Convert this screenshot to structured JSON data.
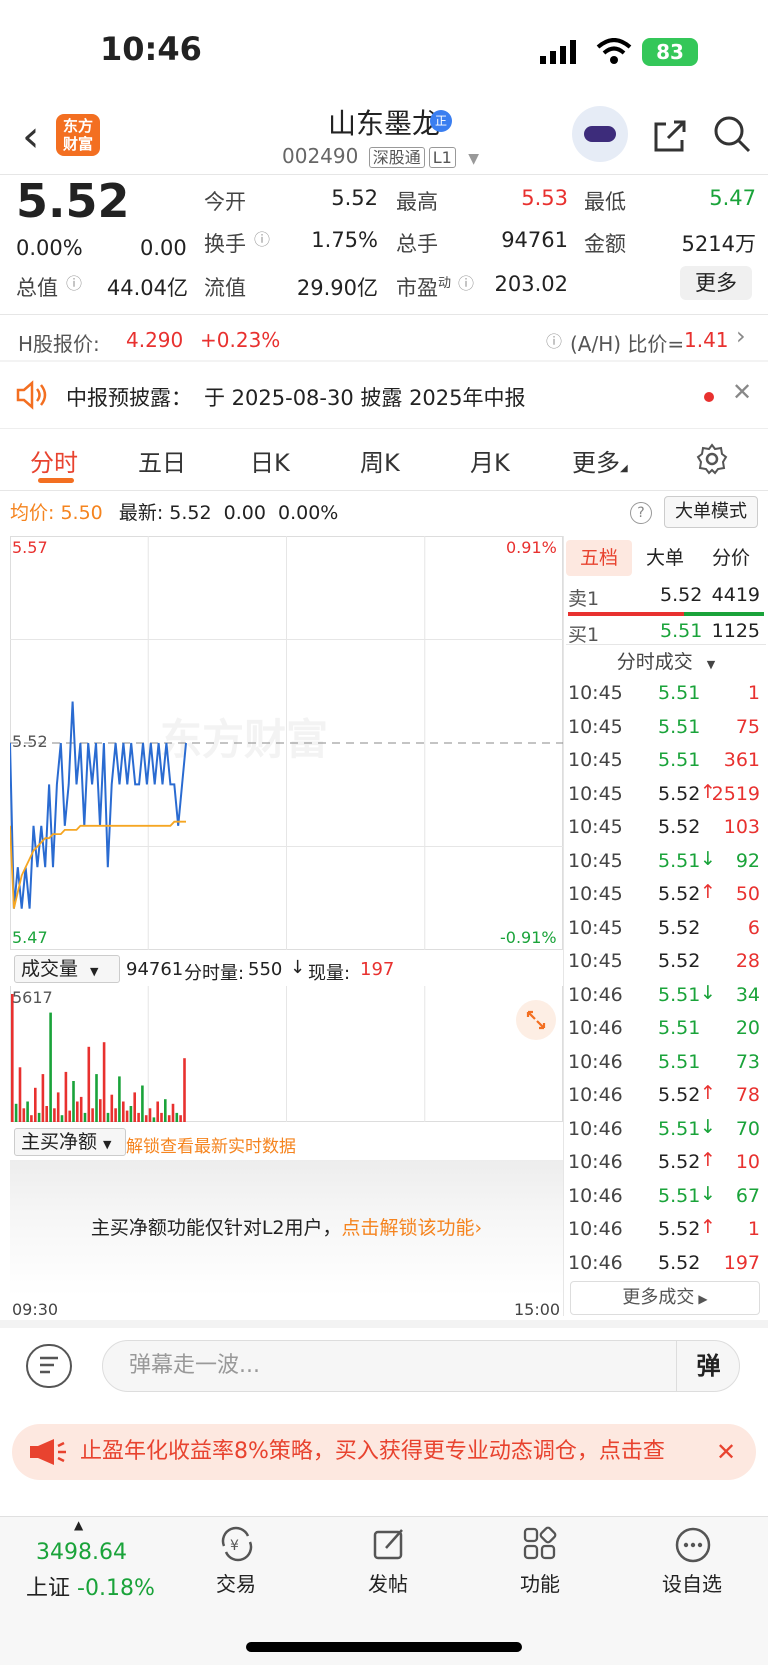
{
  "status": {
    "time": "10:46",
    "battery": "83"
  },
  "header": {
    "logo_line1": "东方",
    "logo_line2": "财富",
    "stock_name": "山东墨龙",
    "badge": "正",
    "code": "002490",
    "tag1": "深股通",
    "tag2": "L1"
  },
  "quote": {
    "price": "5.52",
    "change_pct": "0.00%",
    "change": "0.00",
    "open_label": "今开",
    "open": "5.52",
    "high_label": "最高",
    "high": "5.53",
    "low_label": "最低",
    "low": "5.47",
    "turnover_label": "换手",
    "turnover": "1.75%",
    "volume_label": "总手",
    "volume": "94761",
    "amount_label": "金额",
    "amount": "5214万",
    "mktcap_label": "总值",
    "mktcap": "44.04亿",
    "float_label": "流值",
    "float": "29.90亿",
    "pe_label": "市盈",
    "pe_sup": "动",
    "pe": "203.02",
    "more": "更多"
  },
  "hshare": {
    "label": "H股报价:",
    "price": "4.290",
    "change": "+0.23%",
    "ah_label": "(A/H) 比价=",
    "ah_value": "1.41"
  },
  "notice": {
    "label": "中报预披露：",
    "text": "于 2025-08-30 披露 2025年中报"
  },
  "tabs": [
    "分时",
    "五日",
    "日K",
    "周K",
    "月K",
    "更多"
  ],
  "chart_info": {
    "avg_label": "均价:",
    "avg": "5.50",
    "latest_label": "最新:",
    "latest": "5.52",
    "chg": "0.00",
    "pct": "0.00%",
    "big_order_mode": "大单模式"
  },
  "chart_data": {
    "type": "line",
    "x": [
      "09:30",
      "15:00"
    ],
    "y_range": [
      5.47,
      5.57
    ],
    "pct_range": [
      "-0.91%",
      "0.91%"
    ],
    "y_top": "5.57",
    "y_bottom": "5.47",
    "y_mid": "5.52",
    "pct_top": "0.91%",
    "pct_bottom": "-0.91%",
    "watermark": "东方财富",
    "series": [
      {
        "values": [
          5.52,
          5.48,
          5.49,
          5.48,
          5.49,
          5.48,
          5.5,
          5.49,
          5.5,
          5.49,
          5.51,
          5.49,
          5.51,
          5.52,
          5.5,
          5.51,
          5.53,
          5.51,
          5.52,
          5.5,
          5.52,
          5.51,
          5.52,
          5.5,
          5.52,
          5.49,
          5.51,
          5.52,
          5.51,
          5.52,
          5.51,
          5.52,
          5.51,
          5.51,
          5.52,
          5.51,
          5.52,
          5.51,
          5.52,
          5.51,
          5.52,
          5.51,
          5.51,
          5.5,
          5.51,
          5.52
        ]
      },
      {
        "values": [
          5.5,
          5.48,
          5.484,
          5.488,
          5.49,
          5.492,
          5.494,
          5.495,
          5.496,
          5.497,
          5.497,
          5.498,
          5.498,
          5.498,
          5.499,
          5.499,
          5.499,
          5.499,
          5.5,
          5.5,
          5.5,
          5.5,
          5.5,
          5.5,
          5.5,
          5.5,
          5.5,
          5.5,
          5.5,
          5.5,
          5.5,
          5.5,
          5.5,
          5.5,
          5.5,
          5.5,
          5.5,
          5.5,
          5.5,
          5.5,
          5.5,
          5.5,
          5.501,
          5.501,
          5.501,
          5.501
        ]
      }
    ],
    "volume_max": "5617",
    "volumes": [
      5617,
      800,
      2400,
      600,
      900,
      300,
      1500,
      400,
      2100,
      700,
      4800,
      600,
      1300,
      300,
      2200,
      500,
      1800,
      900,
      1100,
      400,
      3300,
      600,
      2100,
      1000,
      3500,
      400,
      1200,
      600,
      2000,
      900,
      500,
      700,
      1300,
      400,
      1600,
      300,
      600,
      200,
      900,
      400,
      1000,
      300,
      800,
      400,
      300,
      2800
    ]
  },
  "volume_panel": {
    "select": "成交量",
    "total": "94761",
    "tick_vol_label": "分时量:",
    "tick_vol": "550",
    "cur_vol_label": "现量:",
    "cur_vol": "197"
  },
  "netbuy": {
    "select": "主买净额",
    "unlock_tip": "解锁查看最新实时数据",
    "msg": "主买净额功能仅针对L2用户，",
    "link": "点击解锁该功能"
  },
  "x_start": "09:30",
  "x_end": "15:00",
  "right_panel": {
    "tabs": [
      "五档",
      "大单",
      "分价"
    ],
    "sell1_label": "卖1",
    "sell1_price": "5.52",
    "sell1_vol": "4419",
    "buy1_label": "买1",
    "buy1_price": "5.51",
    "buy1_vol": "1125",
    "trades_header": "分时成交",
    "trades": [
      {
        "t": "10:45",
        "p": "5.51",
        "arrow": "",
        "v": "1",
        "pc": "green",
        "vc": "red"
      },
      {
        "t": "10:45",
        "p": "5.51",
        "arrow": "",
        "v": "75",
        "pc": "green",
        "vc": "red"
      },
      {
        "t": "10:45",
        "p": "5.51",
        "arrow": "",
        "v": "361",
        "pc": "green",
        "vc": "red"
      },
      {
        "t": "10:45",
        "p": "5.52",
        "arrow": "↑",
        "v": "2519",
        "pc": "black",
        "vc": "red"
      },
      {
        "t": "10:45",
        "p": "5.52",
        "arrow": "",
        "v": "103",
        "pc": "black",
        "vc": "red"
      },
      {
        "t": "10:45",
        "p": "5.51",
        "arrow": "↓",
        "v": "92",
        "pc": "green",
        "vc": "green"
      },
      {
        "t": "10:45",
        "p": "5.52",
        "arrow": "↑",
        "v": "50",
        "pc": "black",
        "vc": "red"
      },
      {
        "t": "10:45",
        "p": "5.52",
        "arrow": "",
        "v": "6",
        "pc": "black",
        "vc": "red"
      },
      {
        "t": "10:45",
        "p": "5.52",
        "arrow": "",
        "v": "28",
        "pc": "black",
        "vc": "red"
      },
      {
        "t": "10:46",
        "p": "5.51",
        "arrow": "↓",
        "v": "34",
        "pc": "green",
        "vc": "green"
      },
      {
        "t": "10:46",
        "p": "5.51",
        "arrow": "",
        "v": "20",
        "pc": "green",
        "vc": "green"
      },
      {
        "t": "10:46",
        "p": "5.51",
        "arrow": "",
        "v": "73",
        "pc": "green",
        "vc": "green"
      },
      {
        "t": "10:46",
        "p": "5.52",
        "arrow": "↑",
        "v": "78",
        "pc": "black",
        "vc": "red"
      },
      {
        "t": "10:46",
        "p": "5.51",
        "arrow": "↓",
        "v": "70",
        "pc": "green",
        "vc": "green"
      },
      {
        "t": "10:46",
        "p": "5.52",
        "arrow": "↑",
        "v": "10",
        "pc": "black",
        "vc": "red"
      },
      {
        "t": "10:46",
        "p": "5.51",
        "arrow": "↓",
        "v": "67",
        "pc": "green",
        "vc": "green"
      },
      {
        "t": "10:46",
        "p": "5.52",
        "arrow": "↑",
        "v": "1",
        "pc": "black",
        "vc": "red"
      },
      {
        "t": "10:46",
        "p": "5.52",
        "arrow": "",
        "v": "197",
        "pc": "black",
        "vc": "red"
      }
    ],
    "more_trades": "更多成交"
  },
  "bottom": {
    "danmu_placeholder": "弹幕走一波...",
    "danmu_btn": "弹",
    "ad": "止盈年化收益率8%策略，买入获得更专业动态调仓，点击查",
    "index_value": "3498.64",
    "index_name": "上证",
    "index_change": "-0.18%",
    "nav": [
      "交易",
      "发帖",
      "功能",
      "设自选"
    ]
  },
  "colors": {
    "up": "#e8312f",
    "down": "#1aa33a",
    "accent": "#f36f21",
    "price_line": "#2a6bd1",
    "avg_line": "#f5a623"
  }
}
